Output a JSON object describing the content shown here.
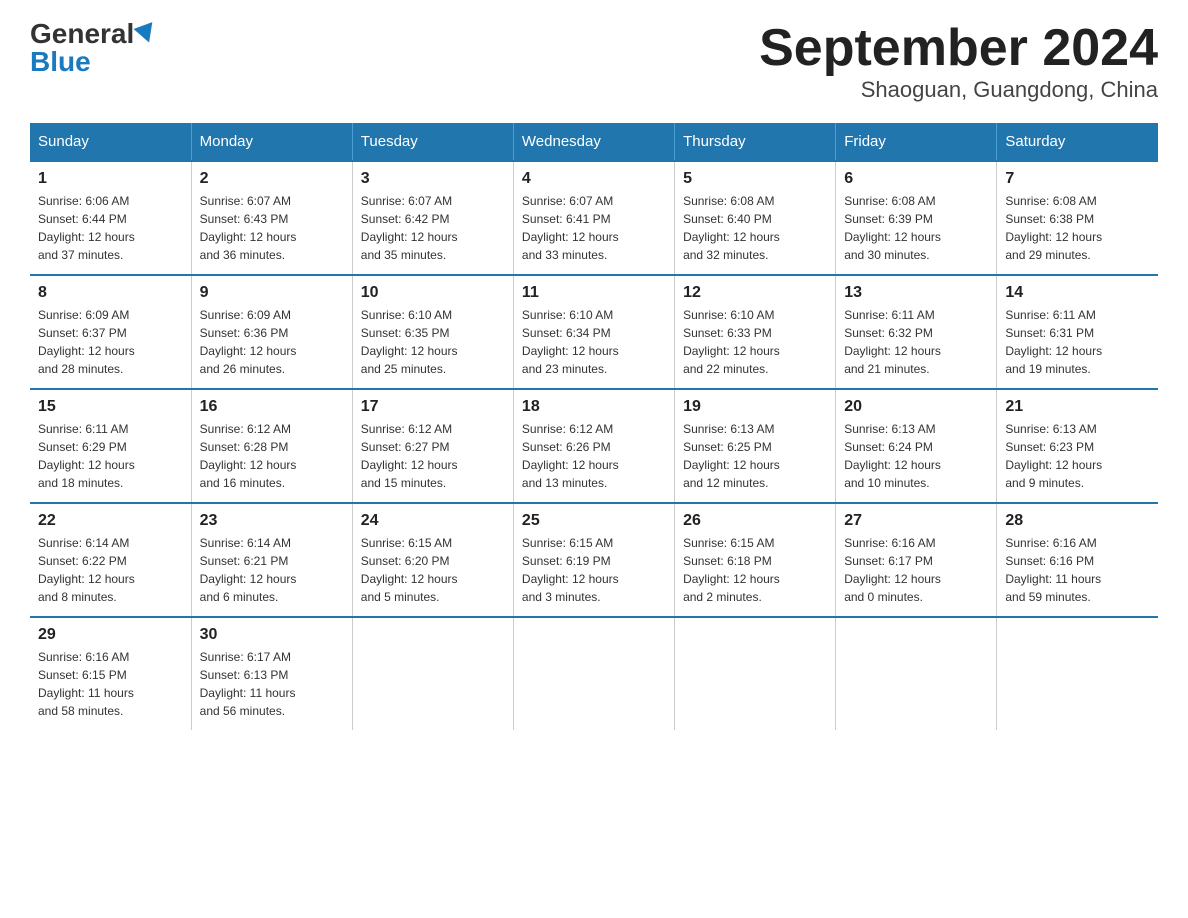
{
  "logo": {
    "general": "General",
    "blue": "Blue"
  },
  "title": "September 2024",
  "subtitle": "Shaoguan, Guangdong, China",
  "days_of_week": [
    "Sunday",
    "Monday",
    "Tuesday",
    "Wednesday",
    "Thursday",
    "Friday",
    "Saturday"
  ],
  "weeks": [
    [
      {
        "day": "1",
        "sunrise": "6:06 AM",
        "sunset": "6:44 PM",
        "daylight": "12 hours and 37 minutes."
      },
      {
        "day": "2",
        "sunrise": "6:07 AM",
        "sunset": "6:43 PM",
        "daylight": "12 hours and 36 minutes."
      },
      {
        "day": "3",
        "sunrise": "6:07 AM",
        "sunset": "6:42 PM",
        "daylight": "12 hours and 35 minutes."
      },
      {
        "day": "4",
        "sunrise": "6:07 AM",
        "sunset": "6:41 PM",
        "daylight": "12 hours and 33 minutes."
      },
      {
        "day": "5",
        "sunrise": "6:08 AM",
        "sunset": "6:40 PM",
        "daylight": "12 hours and 32 minutes."
      },
      {
        "day": "6",
        "sunrise": "6:08 AM",
        "sunset": "6:39 PM",
        "daylight": "12 hours and 30 minutes."
      },
      {
        "day": "7",
        "sunrise": "6:08 AM",
        "sunset": "6:38 PM",
        "daylight": "12 hours and 29 minutes."
      }
    ],
    [
      {
        "day": "8",
        "sunrise": "6:09 AM",
        "sunset": "6:37 PM",
        "daylight": "12 hours and 28 minutes."
      },
      {
        "day": "9",
        "sunrise": "6:09 AM",
        "sunset": "6:36 PM",
        "daylight": "12 hours and 26 minutes."
      },
      {
        "day": "10",
        "sunrise": "6:10 AM",
        "sunset": "6:35 PM",
        "daylight": "12 hours and 25 minutes."
      },
      {
        "day": "11",
        "sunrise": "6:10 AM",
        "sunset": "6:34 PM",
        "daylight": "12 hours and 23 minutes."
      },
      {
        "day": "12",
        "sunrise": "6:10 AM",
        "sunset": "6:33 PM",
        "daylight": "12 hours and 22 minutes."
      },
      {
        "day": "13",
        "sunrise": "6:11 AM",
        "sunset": "6:32 PM",
        "daylight": "12 hours and 21 minutes."
      },
      {
        "day": "14",
        "sunrise": "6:11 AM",
        "sunset": "6:31 PM",
        "daylight": "12 hours and 19 minutes."
      }
    ],
    [
      {
        "day": "15",
        "sunrise": "6:11 AM",
        "sunset": "6:29 PM",
        "daylight": "12 hours and 18 minutes."
      },
      {
        "day": "16",
        "sunrise": "6:12 AM",
        "sunset": "6:28 PM",
        "daylight": "12 hours and 16 minutes."
      },
      {
        "day": "17",
        "sunrise": "6:12 AM",
        "sunset": "6:27 PM",
        "daylight": "12 hours and 15 minutes."
      },
      {
        "day": "18",
        "sunrise": "6:12 AM",
        "sunset": "6:26 PM",
        "daylight": "12 hours and 13 minutes."
      },
      {
        "day": "19",
        "sunrise": "6:13 AM",
        "sunset": "6:25 PM",
        "daylight": "12 hours and 12 minutes."
      },
      {
        "day": "20",
        "sunrise": "6:13 AM",
        "sunset": "6:24 PM",
        "daylight": "12 hours and 10 minutes."
      },
      {
        "day": "21",
        "sunrise": "6:13 AM",
        "sunset": "6:23 PM",
        "daylight": "12 hours and 9 minutes."
      }
    ],
    [
      {
        "day": "22",
        "sunrise": "6:14 AM",
        "sunset": "6:22 PM",
        "daylight": "12 hours and 8 minutes."
      },
      {
        "day": "23",
        "sunrise": "6:14 AM",
        "sunset": "6:21 PM",
        "daylight": "12 hours and 6 minutes."
      },
      {
        "day": "24",
        "sunrise": "6:15 AM",
        "sunset": "6:20 PM",
        "daylight": "12 hours and 5 minutes."
      },
      {
        "day": "25",
        "sunrise": "6:15 AM",
        "sunset": "6:19 PM",
        "daylight": "12 hours and 3 minutes."
      },
      {
        "day": "26",
        "sunrise": "6:15 AM",
        "sunset": "6:18 PM",
        "daylight": "12 hours and 2 minutes."
      },
      {
        "day": "27",
        "sunrise": "6:16 AM",
        "sunset": "6:17 PM",
        "daylight": "12 hours and 0 minutes."
      },
      {
        "day": "28",
        "sunrise": "6:16 AM",
        "sunset": "6:16 PM",
        "daylight": "11 hours and 59 minutes."
      }
    ],
    [
      {
        "day": "29",
        "sunrise": "6:16 AM",
        "sunset": "6:15 PM",
        "daylight": "11 hours and 58 minutes."
      },
      {
        "day": "30",
        "sunrise": "6:17 AM",
        "sunset": "6:13 PM",
        "daylight": "11 hours and 56 minutes."
      },
      null,
      null,
      null,
      null,
      null
    ]
  ]
}
